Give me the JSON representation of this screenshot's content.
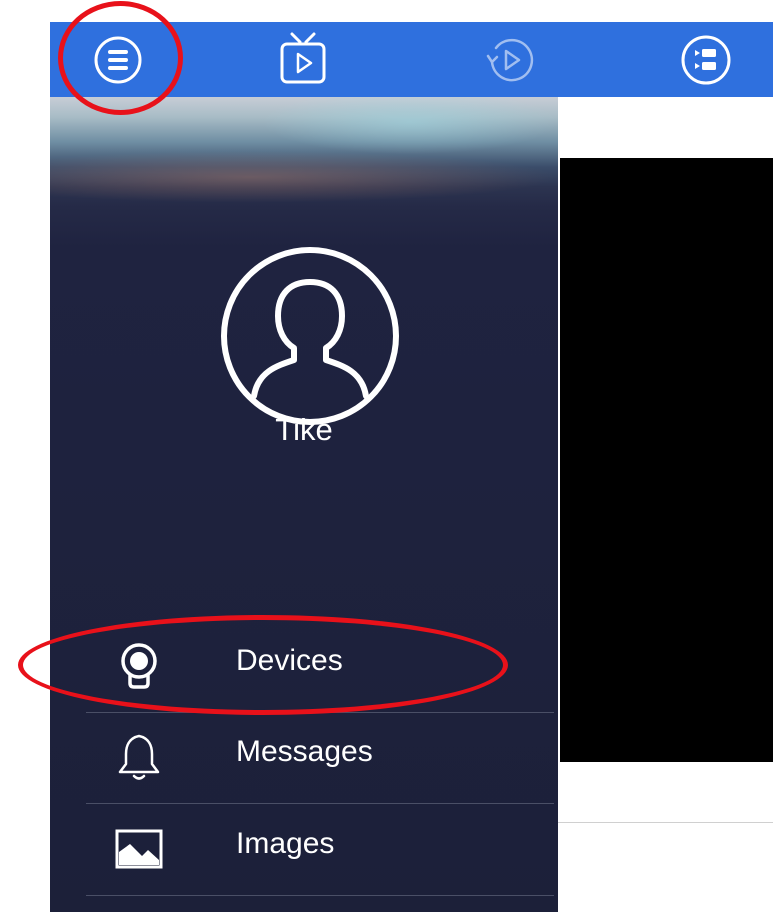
{
  "top_bar": {
    "color": "#2f70de",
    "buttons": [
      {
        "icon": "menu-icon"
      },
      {
        "icon": "live-tv-icon"
      },
      {
        "icon": "playback-icon"
      },
      {
        "icon": "device-list-icon"
      }
    ]
  },
  "drawer": {
    "avatar_icon": "user-avatar-icon",
    "username": "Tike",
    "menu": [
      {
        "icon": "camera-icon",
        "label": "Devices"
      },
      {
        "icon": "bell-icon",
        "label": "Messages"
      },
      {
        "icon": "image-icon",
        "label": "Images"
      }
    ]
  },
  "annotations": {
    "color": "#e8111a",
    "highlights": [
      "menu-button",
      "menu-item-devices"
    ]
  }
}
